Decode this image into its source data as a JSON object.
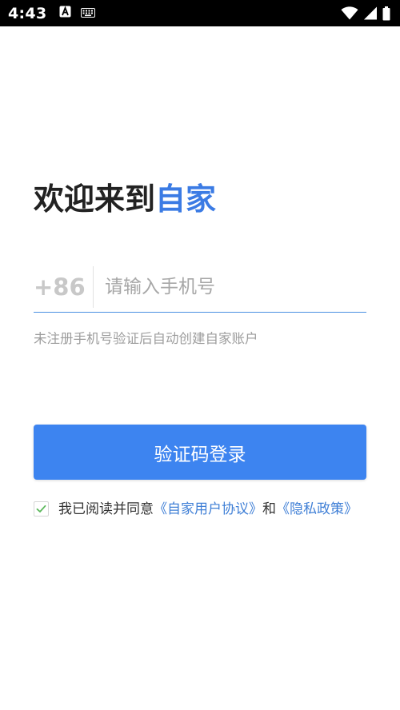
{
  "status_bar": {
    "time": "4:43",
    "icons": [
      "app-notification-icon",
      "keyboard-icon",
      "wifi-icon",
      "signal-icon",
      "battery-icon"
    ]
  },
  "welcome": {
    "prefix": "欢迎来到",
    "brand": "自家"
  },
  "phone": {
    "country_code": "+86",
    "placeholder": "请输入手机号",
    "value": ""
  },
  "hint": "未注册手机号验证后自动创建自家账户",
  "login_button": "验证码登录",
  "agreement": {
    "checked": true,
    "text_prefix": "我已阅读并同意",
    "user_agreement": "《自家用户协议》",
    "conjunction": "和",
    "privacy_policy": "《隐私政策》"
  },
  "colors": {
    "brand": "#3b7be4",
    "button": "#3d84f0",
    "link": "#3f7fd6",
    "underline": "#4a90e2",
    "checkmark": "#5cb85c"
  }
}
